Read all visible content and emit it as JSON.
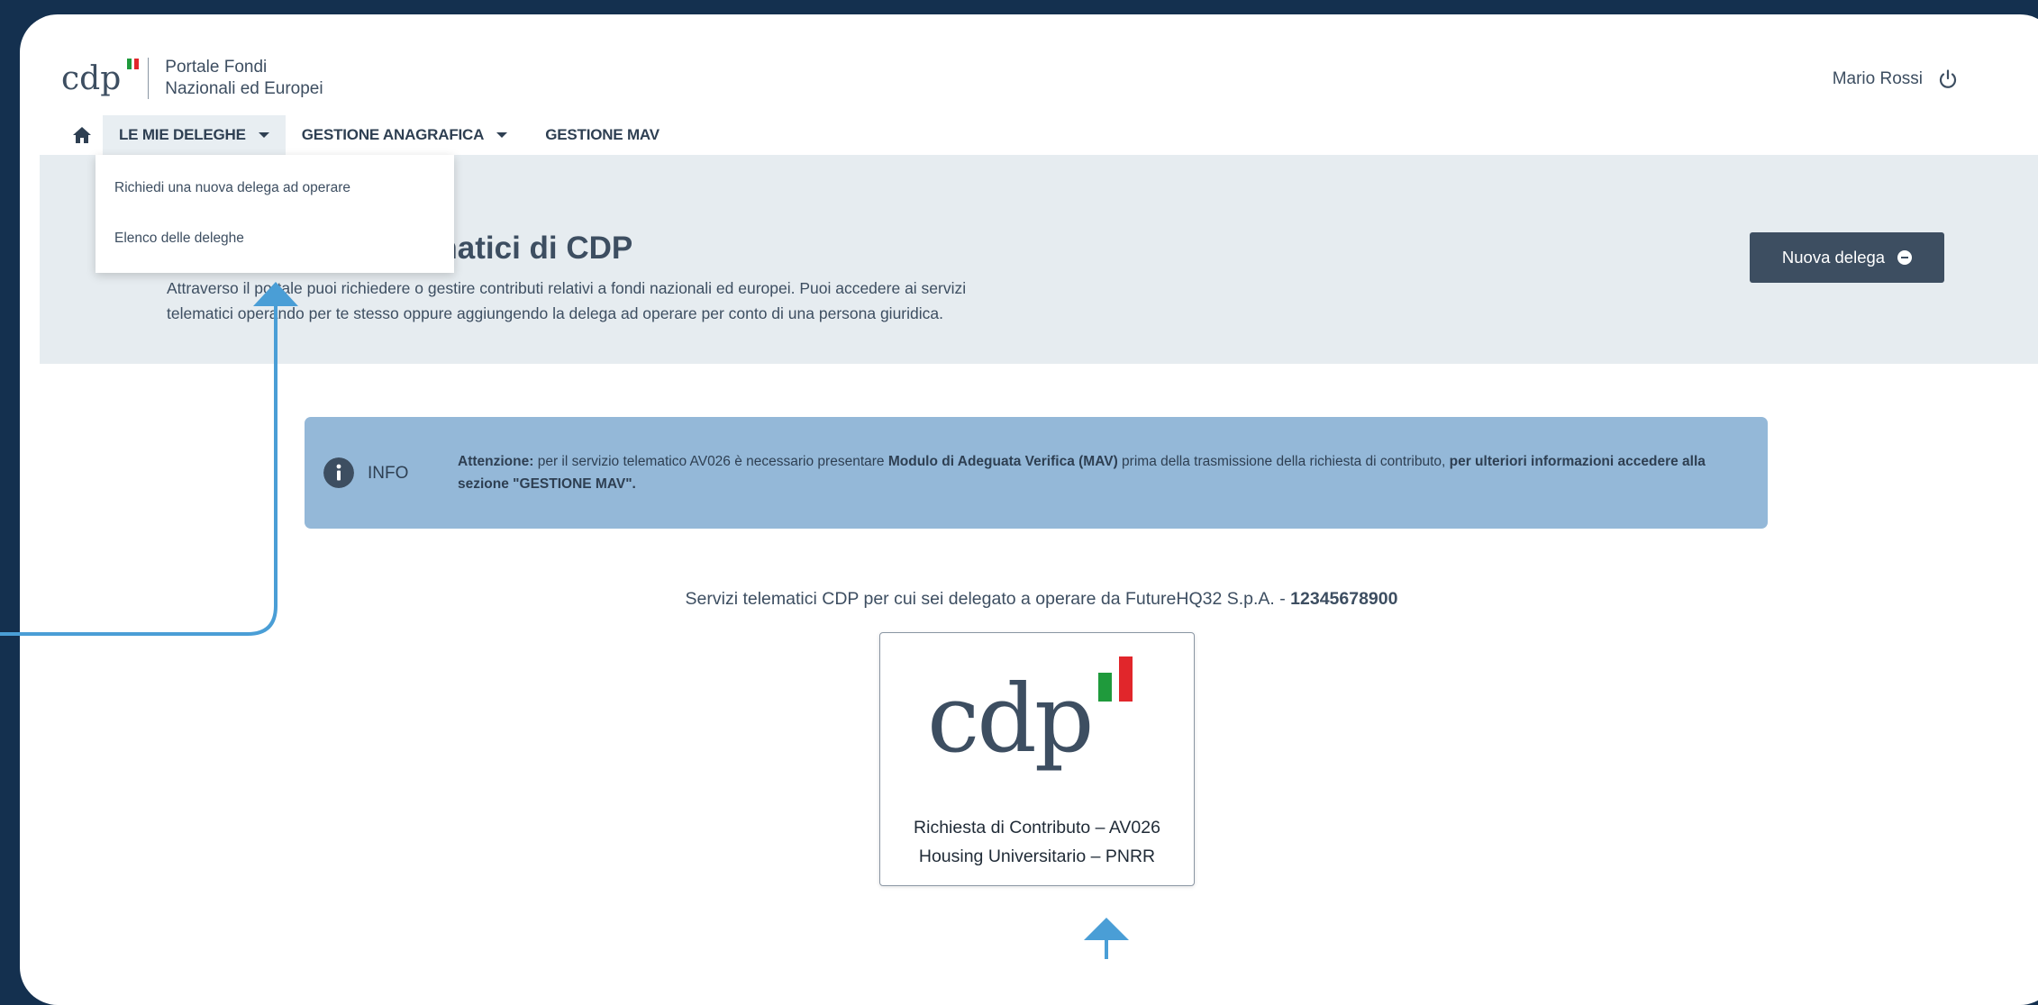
{
  "header": {
    "logo_text": "cdp",
    "portal_line1": "Portale Fondi",
    "portal_line2": "Nazionali ed Europei",
    "user_name": "Mario Rossi",
    "logout_icon": "power-icon"
  },
  "nav": {
    "home_icon": "home-icon",
    "items": [
      {
        "label": "LE MIE DELEGHE"
      },
      {
        "label": "GESTIONE ANAGRAFICA"
      },
      {
        "label": "GESTIONE MAV"
      }
    ]
  },
  "dropdown": {
    "items": [
      {
        "label": "Richiedi una nuova delega ad operare"
      },
      {
        "label": "Elenco delle deleghe"
      }
    ]
  },
  "hero": {
    "title": "elematici di CDP",
    "desc_line1": "Attraverso il portale puoi richiedere o gestire contributi relativi a fondi nazionali ed europei. Puoi accedere ai servizi",
    "desc_line2": "telematici operando per te stesso oppure aggiungendo la delega ad operare per conto di una persona giuridica.",
    "button_label": "Nuova delega"
  },
  "info": {
    "icon": "info-icon",
    "label": "INFO",
    "attention": "Attenzione:",
    "text1": " per il servizio telematico AV026 è necessario presentare ",
    "bold1": "Modulo di Adeguata Verifica (MAV)",
    "text2": " prima della trasmissione della richiesta di contributo, ",
    "bold2": "per ulteriori informazioni accedere alla sezione \"GESTIONE MAV\"."
  },
  "services": {
    "caption": "Servizi telematici CDP per cui sei delegato a operare da FutureHQ32 S.p.A. - ",
    "caption_code": "12345678900",
    "card": {
      "logo_text": "cdp",
      "line1": "Richiesta di Contributo – AV026",
      "line2": "Housing Universitario – PNRR"
    }
  },
  "colors": {
    "background": "#14304f",
    "primary": "#3d4e61",
    "info_bg": "#94b8d8",
    "hero_bg": "#e6ecf0",
    "arrow": "#4a9ed6",
    "flag_green": "#1f9a3c",
    "flag_red": "#e1262b"
  }
}
